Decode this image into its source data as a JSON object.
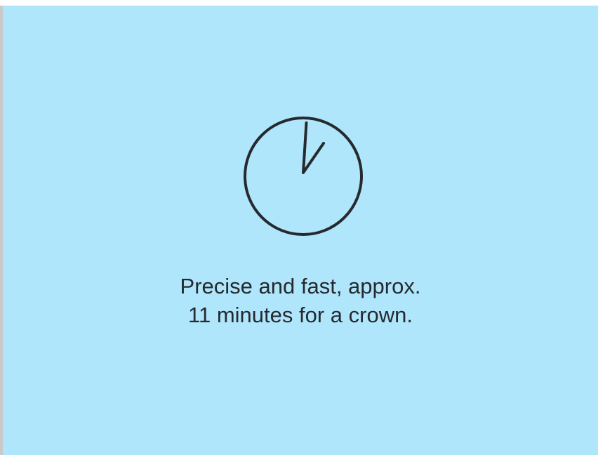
{
  "feature": {
    "icon": "clock-icon",
    "caption": {
      "line1": "Precise and fast, approx.",
      "line2": "11 minutes for a crown."
    }
  },
  "colors": {
    "card_background": "#b0e6fc",
    "icon_stroke": "#252a2e",
    "text": "#252a2e",
    "left_edge": "#c9c9c9"
  }
}
